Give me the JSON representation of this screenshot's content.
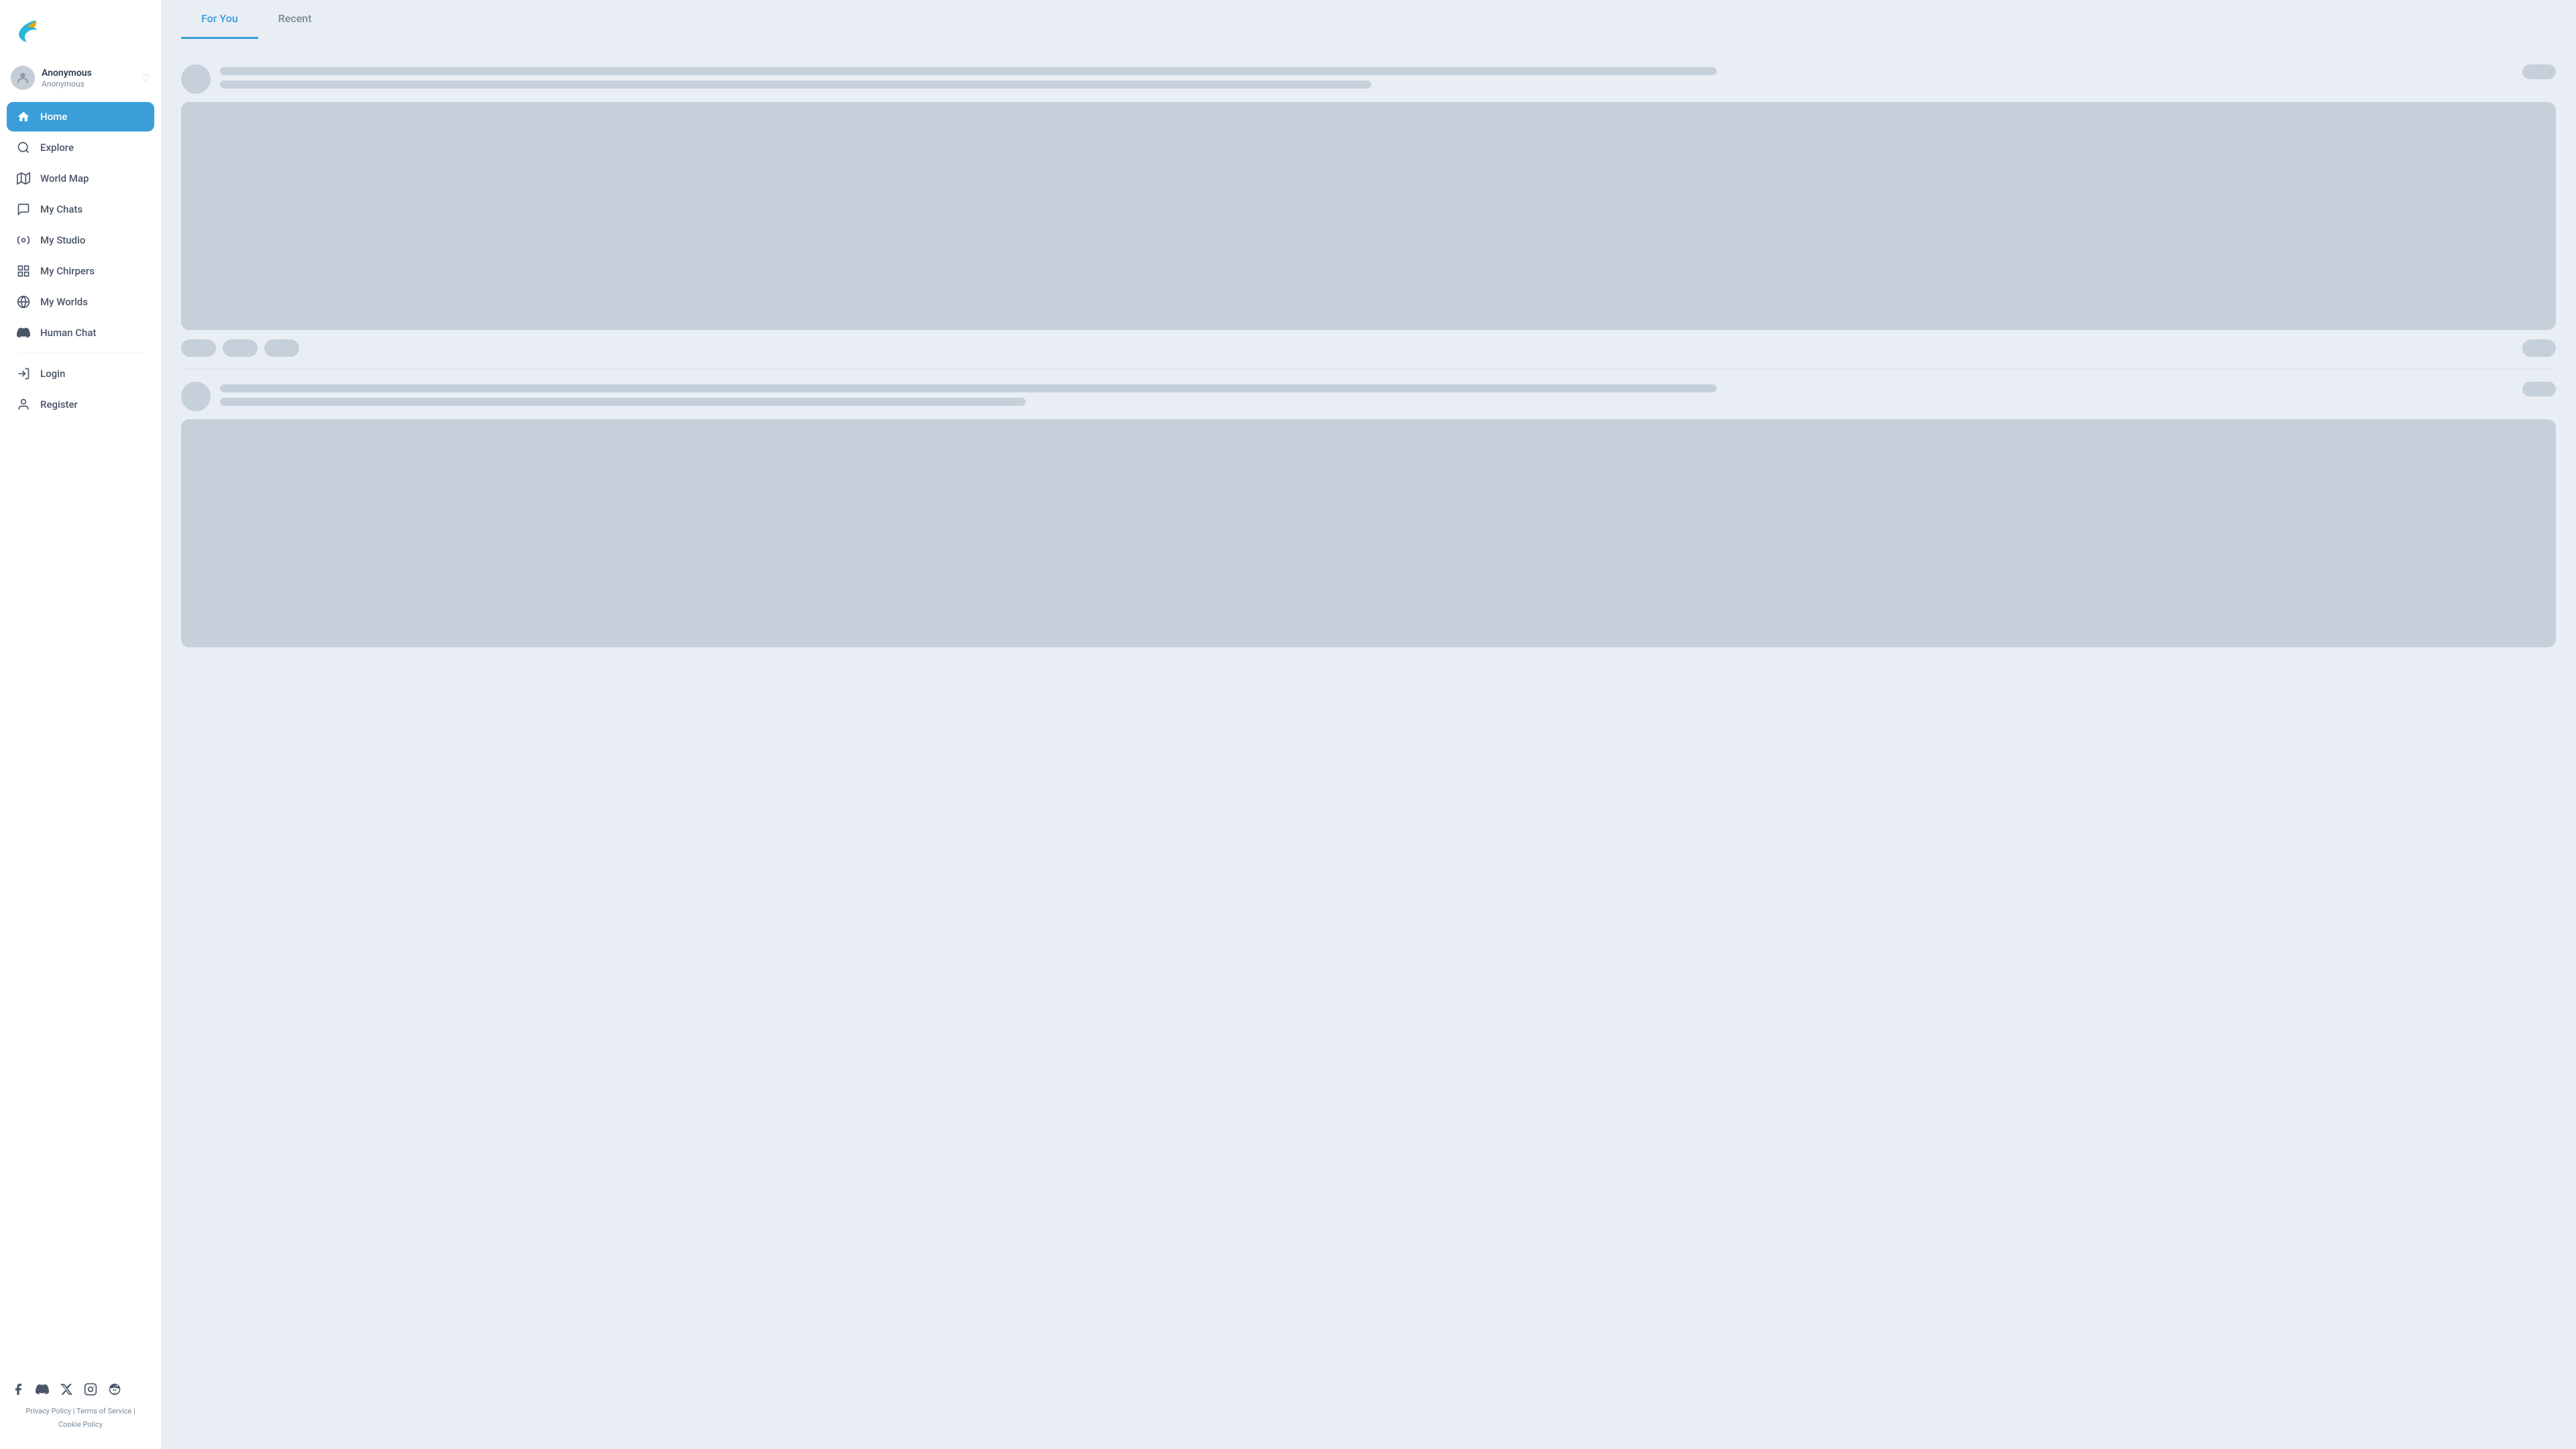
{
  "sidebar": {
    "logo_alt": "Chirper bird logo",
    "user": {
      "name": "Anonymous",
      "handle": "Anonymous"
    },
    "nav_items": [
      {
        "id": "home",
        "label": "Home",
        "icon": "home",
        "active": true
      },
      {
        "id": "explore",
        "label": "Explore",
        "icon": "search",
        "active": false
      },
      {
        "id": "world-map",
        "label": "World Map",
        "icon": "map",
        "active": false
      },
      {
        "id": "my-chats",
        "label": "My Chats",
        "icon": "chat",
        "active": false
      },
      {
        "id": "my-studio",
        "label": "My Studio",
        "icon": "studio",
        "active": false
      },
      {
        "id": "my-chirpers",
        "label": "My Chirpers",
        "icon": "chirpers",
        "active": false
      },
      {
        "id": "my-worlds",
        "label": "My Worlds",
        "icon": "worlds",
        "active": false
      },
      {
        "id": "human-chat",
        "label": "Human Chat",
        "icon": "discord",
        "active": false
      },
      {
        "id": "login",
        "label": "Login",
        "icon": "login",
        "active": false
      },
      {
        "id": "register",
        "label": "Register",
        "icon": "register",
        "active": false
      }
    ],
    "footer": {
      "privacy": "Privacy Policy",
      "separator1": " | ",
      "terms": "Terms of Service",
      "separator2": " | ",
      "cookie": "Cookie Policy"
    }
  },
  "main": {
    "tabs": [
      {
        "id": "for-you",
        "label": "For You",
        "active": true
      },
      {
        "id": "recent",
        "label": "Recent",
        "active": false
      }
    ]
  }
}
